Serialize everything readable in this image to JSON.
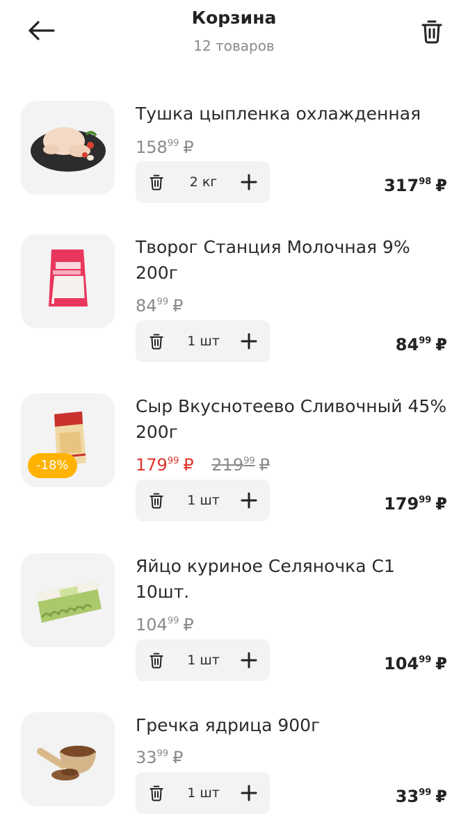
{
  "header": {
    "title": "Корзина",
    "subtitle": "12 товаров",
    "back_icon": "arrow-left-icon",
    "clear_icon": "trash-icon"
  },
  "currency": "₽",
  "items": [
    {
      "name": "Тушка цыпленка охлажденная",
      "price_int": "158",
      "price_frac": "99",
      "qty": "2 кг",
      "total_int": "317",
      "total_frac": "98"
    },
    {
      "name": "Творог Станция Молочная 9% 200г",
      "price_int": "84",
      "price_frac": "99",
      "qty": "1 шт",
      "total_int": "84",
      "total_frac": "99"
    },
    {
      "name": "Сыр Вкуснотеево Сливочный 45% 200г",
      "price_int": "179",
      "price_frac": "99",
      "old_int": "219",
      "old_frac": "99",
      "discount": "-18%",
      "qty": "1 шт",
      "total_int": "179",
      "total_frac": "99"
    },
    {
      "name": "Яйцо куриное Селяночка С1 10шт.",
      "price_int": "104",
      "price_frac": "99",
      "qty": "1 шт",
      "total_int": "104",
      "total_frac": "99"
    },
    {
      "name": "Гречка ядрица 900г",
      "price_int": "33",
      "price_frac": "99",
      "qty": "1 шт",
      "total_int": "33",
      "total_frac": "99"
    }
  ],
  "colors": {
    "sale_price": "#e0352b",
    "discount_badge": "#ffb300",
    "muted_text": "#8a8a8a",
    "card_bg": "#f3f3f3"
  }
}
